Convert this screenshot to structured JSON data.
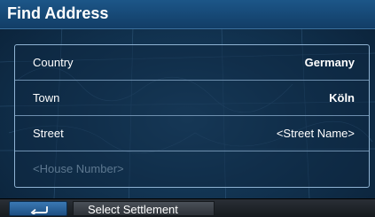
{
  "window": {
    "title": "Find Address"
  },
  "form": {
    "rows": [
      {
        "label": "Country",
        "value": "Germany"
      },
      {
        "label": "Town",
        "value": "Köln"
      },
      {
        "label": "Street",
        "value": "<Street Name>"
      },
      {
        "label": "<House Number>",
        "value": ""
      }
    ]
  },
  "bottom_bar": {
    "back_icon": "back-arrow-icon",
    "settlement_label": "Select Settlement"
  },
  "colors": {
    "accent": "#1c5688",
    "panel_border": "#8fb3d3",
    "disabled_text": "#5d7890"
  }
}
